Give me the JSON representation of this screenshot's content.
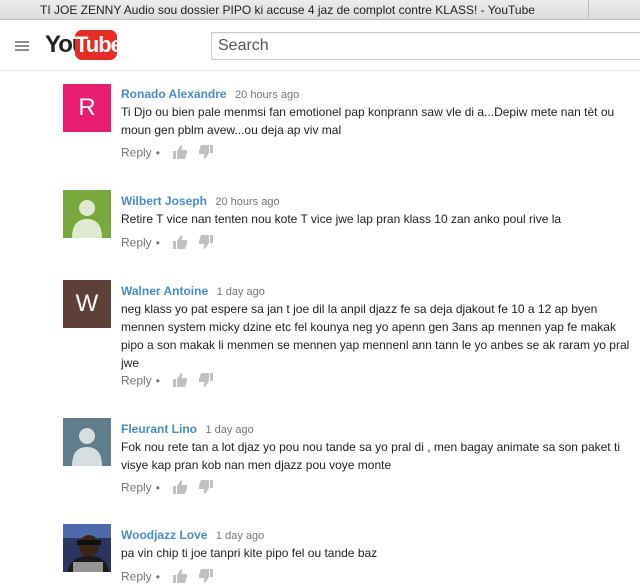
{
  "window": {
    "title": "TI JOE ZENNY Audio sou dossier PIPO ki accuse 4 jaz de complot contre KLASS! - YouTube"
  },
  "header": {
    "logo_you": "You",
    "logo_tube": "Tube",
    "search_placeholder": "Search"
  },
  "colors": {
    "link": "#4a8bc7",
    "brand_red": "#e52d27"
  },
  "comments": [
    {
      "author": "Ronado Alexandre",
      "time": "20 hours ago",
      "text": "Ti Djo ou bien pale menmsi fan emotionel pap konprann saw vle di a...Depiw mete nan tèt ou moun gen pblm avew...ou deja ap viv mal",
      "avatar": {
        "letter": "R",
        "color": "#e91e73"
      },
      "reply": "Reply",
      "dot": "•"
    },
    {
      "author": "Wilbert Joseph",
      "time": "20 hours ago",
      "text": "Retire T vice nan tenten nou kote T vice jwe lap pran klass 10 zan anko poul rive la",
      "avatar": {
        "type": "silhouette",
        "color": "#78a83e"
      },
      "reply": "Reply",
      "dot": "•"
    },
    {
      "author": "Walner Antoine",
      "time": "1 day ago",
      "text": "neg klass yo pat espere sa jan t joe dil la anpil djazz fe sa deja djakout fe 10 a 12 ap byen mennen system micky dzine etc fel kounya neg yo apenn gen 3ans ap mennen yap fe makak pipo a son makak li menmen se mennen yap mennenl ann tann le yo anbes se ak raram yo pral jwe",
      "avatar": {
        "letter": "W",
        "color": "#5d4037"
      },
      "reply": "Reply",
      "dot": "•"
    },
    {
      "author": "Fleurant Lino",
      "time": "1 day ago",
      "text": "Fok nou rete tan a lot djaz yo pou nou tande sa yo pral di , men bagay animate sa son paket ti visye kap pran kob nan men djazz pou voye monte",
      "avatar": {
        "type": "silhouette",
        "color": "#607d8b"
      },
      "reply": "Reply",
      "dot": "•"
    },
    {
      "author": "Woodjazz Love",
      "time": "1 day ago",
      "text": "pa vin chip ti joe tanpri kite pipo fel ou tande baz",
      "avatar": {
        "type": "photo",
        "color": "#2a3560"
      },
      "reply": "Reply",
      "dot": "•"
    }
  ]
}
